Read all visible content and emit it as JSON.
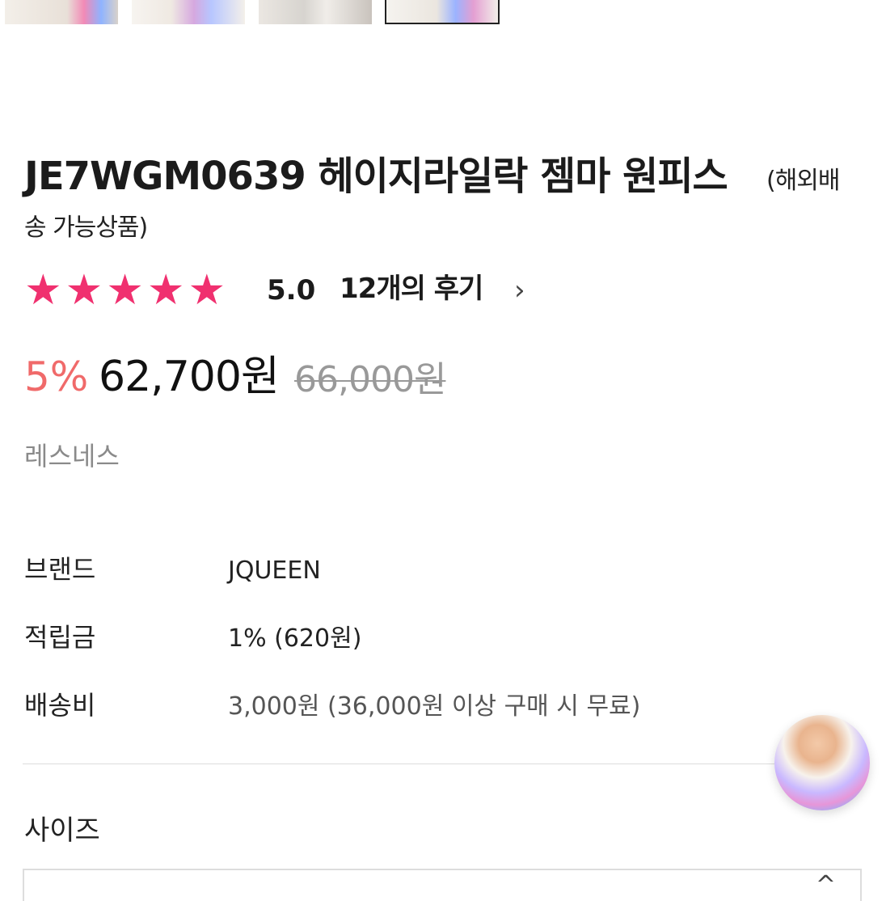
{
  "thumbnails": [
    {
      "name": "product-thumbnail-1"
    },
    {
      "name": "product-thumbnail-2"
    },
    {
      "name": "product-thumbnail-3"
    },
    {
      "name": "product-thumbnail-4",
      "selected": true
    }
  ],
  "product": {
    "title": "JE7WGM0639 헤이지라일락 젬마 원피스",
    "title_note_part1": "(해외배",
    "title_note_part2": "송 가능상품)"
  },
  "rating": {
    "stars": "★★★★★",
    "score": "5.0",
    "reviews_label": "12개의 후기",
    "chevron": "›",
    "star_color": "#f0306f"
  },
  "pricing": {
    "discount": "5%",
    "price": "62,700원",
    "original_price": "66,000원",
    "discount_color": "#f06a6a"
  },
  "seller": "레스네스",
  "info": [
    {
      "label": "브랜드",
      "value": "JQUEEN"
    },
    {
      "label": "적립금",
      "value": "1% (620원)"
    },
    {
      "label": "배송비",
      "value": "3,000원 (36,000원 이상 구매 시 무료)"
    }
  ],
  "options": {
    "size_label": "사이즈",
    "caret": "^"
  },
  "floating_button": {
    "icon": "model-avatar-icon"
  }
}
